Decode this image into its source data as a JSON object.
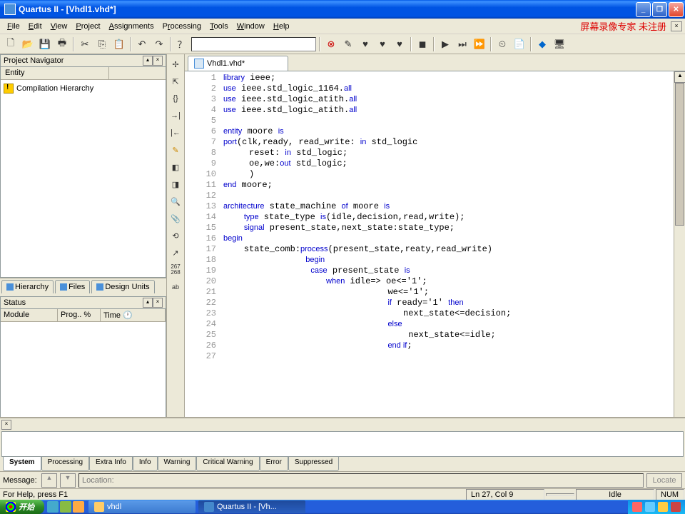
{
  "window": {
    "title": "Quartus II - [Vhdl1.vhd*]"
  },
  "menu": {
    "file": "File",
    "edit": "Edit",
    "view": "View",
    "project": "Project",
    "assignments": "Assignments",
    "processing": "Processing",
    "tools": "Tools",
    "window": "Window",
    "help": "Help",
    "watermark": "屏幕录像专家 未注册"
  },
  "nav": {
    "title": "Project Navigator",
    "entity_col": "Entity",
    "tree_item": "Compilation Hierarchy",
    "tabs": {
      "hierarchy": "Hierarchy",
      "files": "Files",
      "design": "Design Units"
    }
  },
  "status_panel": {
    "title": "Status",
    "cols": {
      "module": "Module",
      "prog": "Prog.. %",
      "time": "Time"
    }
  },
  "editor": {
    "tab": "Vhdl1.vhd*",
    "lines": [
      {
        "n": 1,
        "t": [
          [
            "kw",
            "library"
          ],
          [
            "",
            " ieee;"
          ]
        ]
      },
      {
        "n": 2,
        "t": [
          [
            "kw",
            "use"
          ],
          [
            "",
            " ieee.std_logic_1164."
          ],
          [
            "kw",
            "all"
          ]
        ]
      },
      {
        "n": 3,
        "t": [
          [
            "kw",
            "use"
          ],
          [
            "",
            " ieee.std_logic_atith."
          ],
          [
            "kw",
            "all"
          ]
        ]
      },
      {
        "n": 4,
        "t": [
          [
            "kw",
            "use"
          ],
          [
            "",
            " ieee.std_logic_atith."
          ],
          [
            "kw",
            "all"
          ]
        ]
      },
      {
        "n": 5,
        "t": [
          [
            "",
            ""
          ]
        ]
      },
      {
        "n": 6,
        "t": [
          [
            "kw",
            "entity"
          ],
          [
            "",
            " moore "
          ],
          [
            "kw",
            "is"
          ]
        ]
      },
      {
        "n": 7,
        "t": [
          [
            "kw",
            "port"
          ],
          [
            "",
            "(clk,ready, read_write: "
          ],
          [
            "kw",
            "in"
          ],
          [
            "",
            " std_logic"
          ]
        ]
      },
      {
        "n": 8,
        "t": [
          [
            "",
            "     reset: "
          ],
          [
            "kw",
            "in"
          ],
          [
            "",
            " std_logic;"
          ]
        ]
      },
      {
        "n": 9,
        "t": [
          [
            "",
            "     oe,we:"
          ],
          [
            "kw",
            "out"
          ],
          [
            "",
            " std_logic;"
          ]
        ]
      },
      {
        "n": 10,
        "t": [
          [
            "",
            "     )"
          ]
        ]
      },
      {
        "n": 11,
        "t": [
          [
            "kw",
            "end"
          ],
          [
            "",
            " moore;"
          ]
        ]
      },
      {
        "n": 12,
        "t": [
          [
            "",
            ""
          ]
        ]
      },
      {
        "n": 13,
        "t": [
          [
            "kw",
            "architecture"
          ],
          [
            "",
            " state_machine "
          ],
          [
            "kw",
            "of"
          ],
          [
            "",
            " moore "
          ],
          [
            "kw",
            "is"
          ]
        ]
      },
      {
        "n": 14,
        "t": [
          [
            "",
            "    "
          ],
          [
            "kw",
            "type"
          ],
          [
            "",
            " state_type "
          ],
          [
            "kw",
            "is"
          ],
          [
            "",
            "(idle,decision,read,write);"
          ]
        ]
      },
      {
        "n": 15,
        "t": [
          [
            "",
            "    "
          ],
          [
            "kw",
            "signal"
          ],
          [
            "",
            " present_state,next_state:state_type;"
          ]
        ]
      },
      {
        "n": 16,
        "t": [
          [
            "kw",
            "begin"
          ]
        ]
      },
      {
        "n": 17,
        "t": [
          [
            "",
            "    state_comb:"
          ],
          [
            "kw",
            "process"
          ],
          [
            "",
            "(present_state,reaty,read_write)"
          ]
        ]
      },
      {
        "n": 18,
        "t": [
          [
            "",
            "                "
          ],
          [
            "kw",
            "begin"
          ]
        ]
      },
      {
        "n": 19,
        "t": [
          [
            "",
            "                 "
          ],
          [
            "kw",
            "case"
          ],
          [
            "",
            " present_state "
          ],
          [
            "kw",
            "is"
          ]
        ]
      },
      {
        "n": 20,
        "t": [
          [
            "",
            "                    "
          ],
          [
            "kw",
            "when"
          ],
          [
            "",
            " idle=> oe<='1';"
          ]
        ]
      },
      {
        "n": 21,
        "t": [
          [
            "",
            "                                we<='1';"
          ]
        ]
      },
      {
        "n": 22,
        "t": [
          [
            "",
            "                                "
          ],
          [
            "kw",
            "if"
          ],
          [
            "",
            " ready='1' "
          ],
          [
            "kw",
            "then"
          ]
        ]
      },
      {
        "n": 23,
        "t": [
          [
            "",
            "                                   next_state<=decision;"
          ]
        ]
      },
      {
        "n": 24,
        "t": [
          [
            "",
            "                                "
          ],
          [
            "kw",
            "else"
          ]
        ]
      },
      {
        "n": 25,
        "t": [
          [
            "",
            "                                    next_state<=idle;"
          ]
        ]
      },
      {
        "n": 26,
        "t": [
          [
            "",
            "                                "
          ],
          [
            "kw",
            "end if"
          ],
          [
            "",
            ";"
          ]
        ]
      },
      {
        "n": 27,
        "t": [
          [
            "",
            ""
          ]
        ]
      }
    ],
    "vtool_linecount": "267\n268"
  },
  "messages": {
    "tabs": {
      "system": "System",
      "processing": "Processing",
      "extra": "Extra Info",
      "info": "Info",
      "warning": "Warning",
      "critical": "Critical Warning",
      "error": "Error",
      "suppressed": "Suppressed"
    },
    "label": "Message:",
    "loc_placeholder": "Location:",
    "locate": "Locate"
  },
  "status": {
    "help": "For Help, press F1",
    "pos": "Ln 27, Col 9",
    "idle": "Idle",
    "num": "NUM"
  },
  "taskbar": {
    "start": "开始",
    "vhdl": "vhdl",
    "quartus": "Quartus II - [Vh..."
  }
}
